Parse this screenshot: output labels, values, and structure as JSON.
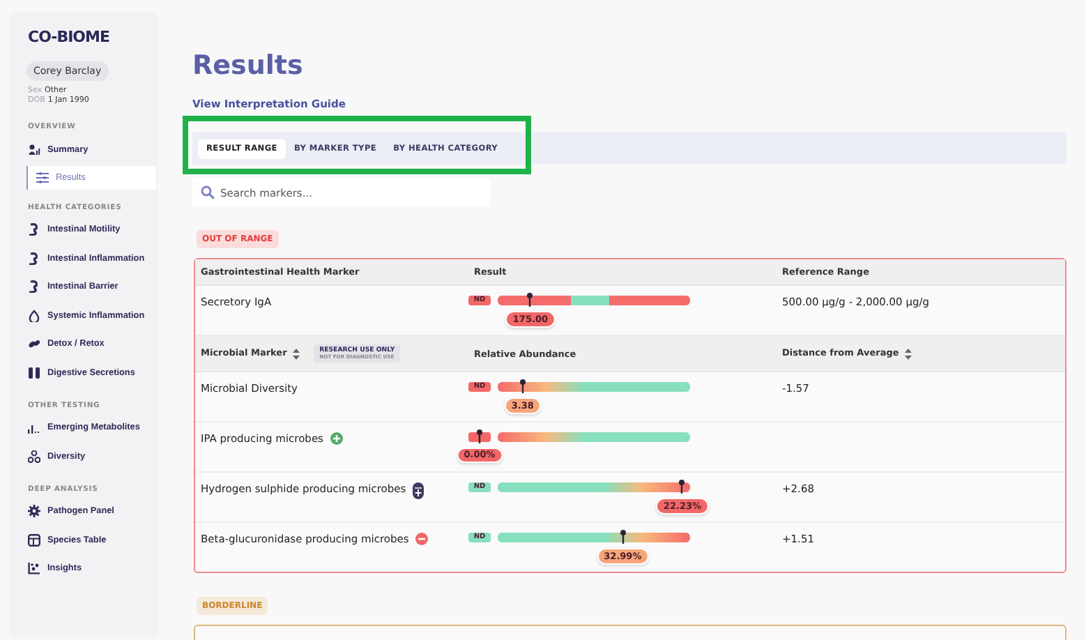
{
  "sidebar": {
    "logo": "CO-BIOME",
    "patient": {
      "name": "Corey Barclay",
      "fields": [
        {
          "label": "Sex",
          "value": "Other"
        },
        {
          "label": "DOB",
          "value": "1 Jan 1990"
        }
      ]
    },
    "sections": [
      {
        "title": "OVERVIEW",
        "items": [
          {
            "label": "Summary",
            "selected": false
          },
          {
            "label": "Results",
            "selected": true
          }
        ]
      },
      {
        "title": "HEALTH CATEGORIES",
        "items": [
          {
            "label": "Intestinal Motility",
            "selected": false
          },
          {
            "label": "Intestinal Inflammation",
            "selected": false
          },
          {
            "label": "Intestinal Barrier",
            "selected": false
          },
          {
            "label": "Systemic Inflammation",
            "selected": false
          },
          {
            "label": "Detox / Retox",
            "selected": false
          },
          {
            "label": "Digestive Secretions",
            "selected": false
          }
        ]
      },
      {
        "title": "OTHER TESTING",
        "items": [
          {
            "label": "Emerging Metabolites",
            "selected": false
          },
          {
            "label": "Diversity",
            "selected": false
          }
        ]
      },
      {
        "title": "DEEP ANALYSIS",
        "items": [
          {
            "label": "Pathogen Panel",
            "selected": false
          },
          {
            "label": "Species Table",
            "selected": false
          },
          {
            "label": "Insights",
            "selected": false
          }
        ]
      }
    ]
  },
  "main": {
    "title": "Results",
    "guide_link": "View Interpretation Guide",
    "tabs": [
      {
        "label": "RESULT RANGE",
        "selected": true
      },
      {
        "label": "BY MARKER TYPE",
        "selected": false
      },
      {
        "label": "BY HEALTH CATEGORY",
        "selected": false
      }
    ],
    "search": {
      "placeholder": "Search markers..."
    },
    "groups": [
      {
        "badge": "OUT OF RANGE",
        "color": "#e33c3c",
        "tables": [
          {
            "columns": [
              {
                "label": "Gastrointestinal Health Marker",
                "sortable": false
              },
              {
                "label": "Result",
                "sortable": false
              },
              {
                "label": "Reference Range",
                "sortable": false
              }
            ],
            "rows": [
              {
                "name": "Secretory IgA",
                "bar": {
                  "kind": "segments",
                  "nd": {
                    "text": "ND",
                    "color": "#f26767",
                    "marked": false
                  },
                  "level": 0.17,
                  "value": "175.00",
                  "color": "#f26767"
                },
                "value_3": "500.00 µg/g - 2,000.00 µg/g"
              }
            ]
          },
          {
            "columns": [
              {
                "label": "Microbial Marker",
                "sortable": true
              },
              {
                "label": "Relative Abundance",
                "sortable": false
              },
              {
                "label": "Distance from Average",
                "sortable": true
              }
            ],
            "research_note": {
              "line_1": "RESEARCH USE ONLY",
              "line_2": "NOT FOR DIAGNOSTIC USE"
            },
            "rows": [
              {
                "name": "Microbial Diversity",
                "bar": {
                  "kind": "low",
                  "nd": {
                    "text": "ND",
                    "color": "#f26767",
                    "marked": false
                  },
                  "level": 0.13,
                  "value": "3.38",
                  "color": "#f5a579"
                },
                "value_3": "-1.57"
              },
              {
                "name": "IPA producing microbes",
                "bar": {
                  "kind": "low",
                  "nd": {
                    "color": "#f26767",
                    "marked": true
                  },
                  "value": "0.00%",
                  "color": "#f26767"
                }
              },
              {
                "name": "Hydrogen sulphide producing microbes",
                "bar": {
                  "kind": "high",
                  "nd": {
                    "text": "ND",
                    "color": "#86dfbd",
                    "marked": false
                  },
                  "level": 0.96,
                  "value": "22.23%",
                  "color": "#f26767"
                },
                "value_3": "+2.68"
              },
              {
                "name": "Beta-glucuronidase producing microbes",
                "bar": {
                  "kind": "high",
                  "nd": {
                    "text": "ND",
                    "color": "#86dfbd",
                    "marked": false
                  },
                  "level": 0.65,
                  "value": "32.99%",
                  "color": "#f5a579"
                },
                "value_3": "+1.51"
              }
            ]
          }
        ]
      },
      {
        "badge": "BORDERLINE",
        "color": "#c9862a"
      }
    ]
  }
}
